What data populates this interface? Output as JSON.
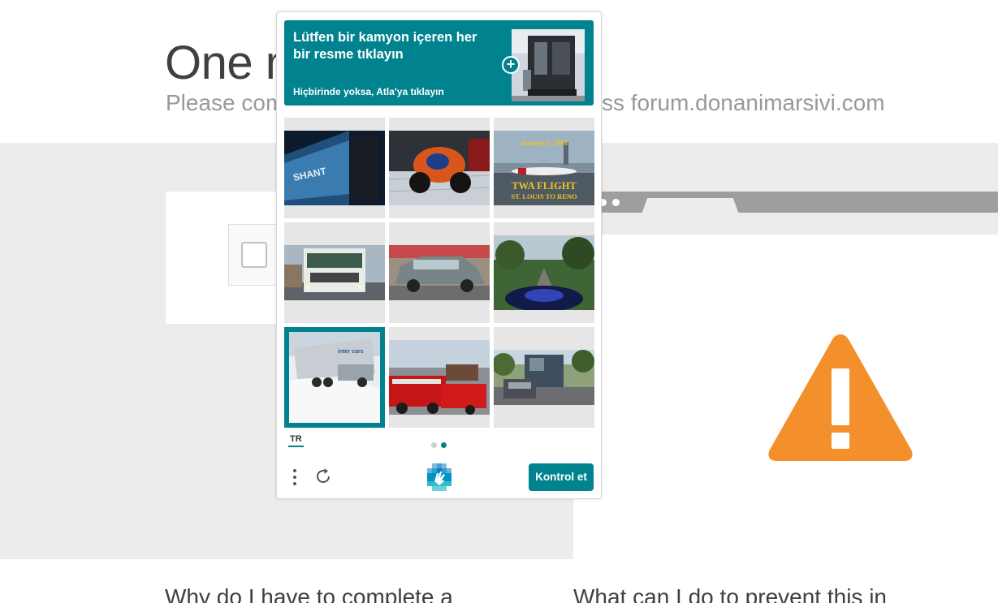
{
  "background_page": {
    "title": "One m",
    "subtitle_left": "Please com",
    "subtitle_right": "ss forum.donanimarsivi.com",
    "bottom_left_heading": "Why do I have to complete a",
    "bottom_right_heading": "What can I do to prevent this in"
  },
  "captcha": {
    "prompt": "Lütfen bir kamyon içeren her bir resme tıklayın",
    "sub_prompt": "Hiçbirinde yoksa, Atla'ya tıklayın",
    "example_icon": "truck-example-image",
    "expand_icon": "plus-icon",
    "tiles": [
      {
        "name": "tile-1",
        "content": "truck-trailer-close-up",
        "selected": false
      },
      {
        "name": "tile-2",
        "content": "motorcycle",
        "selected": false
      },
      {
        "name": "tile-3",
        "content": "airplane",
        "overlay_date": "January 6, 1998",
        "overlay_title": "TWA FLIGHT",
        "overlay_route": "ST. LOUIS TO RENO",
        "selected": false
      },
      {
        "name": "tile-4",
        "content": "truck-front",
        "selected": false
      },
      {
        "name": "tile-5",
        "content": "vintage-car",
        "selected": false
      },
      {
        "name": "tile-6",
        "content": "motorcycle-pov",
        "selected": false
      },
      {
        "name": "tile-7",
        "content": "truck-in-snow",
        "selected": true
      },
      {
        "name": "tile-8",
        "content": "fire-truck",
        "selected": false
      },
      {
        "name": "tile-9",
        "content": "garbage-truck-street",
        "selected": false
      }
    ],
    "language": "TR",
    "page_indicator": {
      "current": 2,
      "total": 2
    },
    "submit_label": "Kontrol et",
    "colors": {
      "accent": "#00838f",
      "warning": "#f4902c"
    }
  }
}
